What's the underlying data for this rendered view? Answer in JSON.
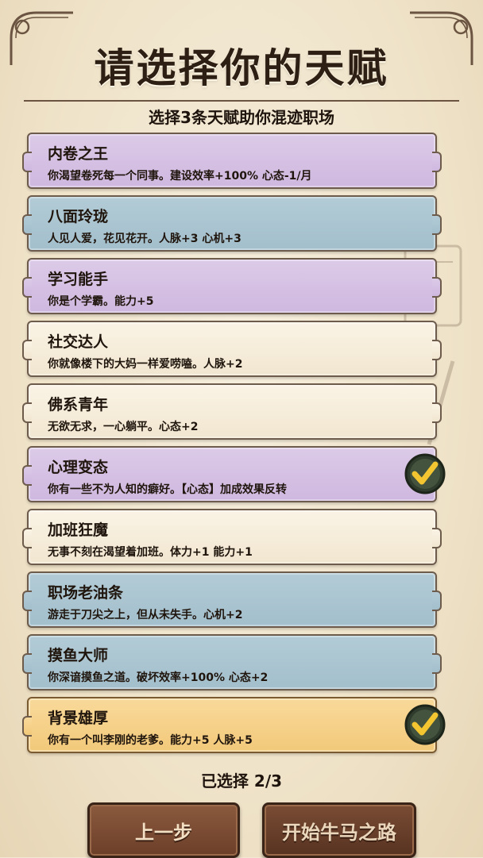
{
  "header": {
    "title": "请选择你的天赋",
    "subtitle": "选择3条天赋助你混迹职场"
  },
  "talents": [
    {
      "name": "内卷之王",
      "desc": "你渴望卷死每一个同事。建设效率+100% 心态-1/月",
      "color": "purple",
      "checked": false
    },
    {
      "name": "八面玲珑",
      "desc": "人见人爱，花见花开。人脉+3 心机+3",
      "color": "blue",
      "checked": false
    },
    {
      "name": "学习能手",
      "desc": "你是个学霸。能力+5",
      "color": "purple",
      "checked": false
    },
    {
      "name": "社交达人",
      "desc": "你就像楼下的大妈一样爱唠嗑。人脉+2",
      "color": "cream",
      "checked": false
    },
    {
      "name": "佛系青年",
      "desc": "无欲无求，一心躺平。心态+2",
      "color": "cream",
      "checked": false
    },
    {
      "name": "心理变态",
      "desc": "你有一些不为人知的癖好。【心态】加成效果反转",
      "color": "purple",
      "checked": true
    },
    {
      "name": "加班狂魔",
      "desc": "无事不刻在渴望着加班。体力+1 能力+1",
      "color": "cream",
      "checked": false
    },
    {
      "name": "职场老油条",
      "desc": "游走于刀尖之上，但从未失手。心机+2",
      "color": "blue",
      "checked": false
    },
    {
      "name": "摸鱼大师",
      "desc": "你深谙摸鱼之道。破坏效率+100% 心态+2",
      "color": "blue",
      "checked": false
    },
    {
      "name": "背景雄厚",
      "desc": "你有一个叫李刚的老爹。能力+5 人脉+5",
      "color": "gold",
      "checked": true
    }
  ],
  "footer": {
    "selected_text": "已选择 2/3",
    "prev_label": "上一步",
    "start_label": "开始牛马之路"
  },
  "icons": {
    "check": "check-badge-icon",
    "corner": "ornament-corner-icon"
  }
}
